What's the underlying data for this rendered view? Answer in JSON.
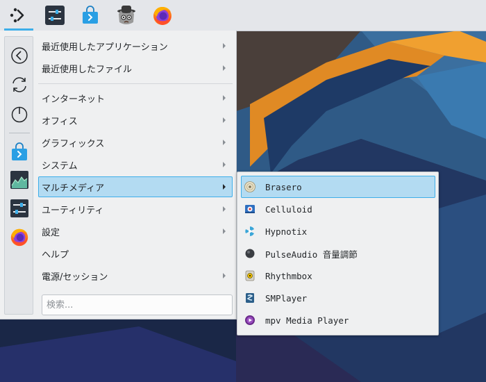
{
  "panel": {
    "buttons": [
      {
        "name": "app-launcher",
        "icon": "kde-launcher-icon"
      },
      {
        "name": "system-settings",
        "icon": "sliders-icon"
      },
      {
        "name": "discover",
        "icon": "shopping-bag-icon"
      },
      {
        "name": "spy-app",
        "icon": "spy-cat-icon"
      },
      {
        "name": "firefox",
        "icon": "firefox-icon"
      }
    ]
  },
  "sidebar": {
    "buttons": [
      "back-icon",
      "refresh-icon",
      "power-icon",
      "discover-icon",
      "system-monitor-icon",
      "settings-icon",
      "firefox-icon"
    ]
  },
  "menu": {
    "items": [
      {
        "label": "最近使用したアプリケーション",
        "has_submenu": true
      },
      {
        "label": "最近使用したファイル",
        "has_submenu": true
      },
      {
        "label": "インターネット",
        "has_submenu": true
      },
      {
        "label": "オフィス",
        "has_submenu": true
      },
      {
        "label": "グラフィックス",
        "has_submenu": true
      },
      {
        "label": "システム",
        "has_submenu": true
      },
      {
        "label": "マルチメディア",
        "has_submenu": true,
        "highlighted": true
      },
      {
        "label": "ユーティリティ",
        "has_submenu": true
      },
      {
        "label": "設定",
        "has_submenu": true
      },
      {
        "label": "ヘルプ",
        "has_submenu": false
      },
      {
        "label": "電源/セッション",
        "has_submenu": true
      }
    ],
    "search_placeholder": "検索..."
  },
  "submenu": {
    "items": [
      {
        "label": "Brasero",
        "icon": "brasero-disc-icon",
        "highlighted": true
      },
      {
        "label": "Celluloid",
        "icon": "celluloid-icon"
      },
      {
        "label": "Hypnotix",
        "icon": "hypnotix-icon"
      },
      {
        "label": "PulseAudio 音量調節",
        "icon": "pulseaudio-icon"
      },
      {
        "label": "Rhythmbox",
        "icon": "rhythmbox-icon"
      },
      {
        "label": "SMPlayer",
        "icon": "smplayer-icon"
      },
      {
        "label": "mpv Media Player",
        "icon": "mpv-icon"
      }
    ]
  },
  "colors": {
    "accent": "#3daee9",
    "highlight": "#b3dbf2",
    "menu_bg": "#eff0f1"
  }
}
